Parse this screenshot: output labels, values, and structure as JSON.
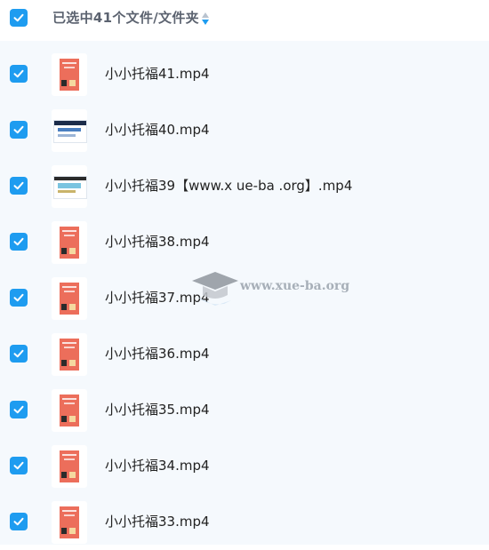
{
  "header": {
    "selection_label": "已选中41个文件/文件夹",
    "checked": true
  },
  "colors": {
    "accent": "#1e9cf0",
    "list_bg": "#f5f9fd",
    "poster": "#ec6e5b"
  },
  "files": [
    {
      "name": "小小托福41.mp4",
      "thumb": "poster"
    },
    {
      "name": "小小托福40.mp4",
      "thumb": "slide"
    },
    {
      "name": "小小托福39【www.x ue-ba .org】.mp4",
      "thumb": "slide-alt"
    },
    {
      "name": "小小托福38.mp4",
      "thumb": "poster"
    },
    {
      "name": "小小托福37.mp4",
      "thumb": "poster"
    },
    {
      "name": "小小托福36.mp4",
      "thumb": "poster"
    },
    {
      "name": "小小托福35.mp4",
      "thumb": "poster"
    },
    {
      "name": "小小托福34.mp4",
      "thumb": "poster"
    },
    {
      "name": "小小托福33.mp4",
      "thumb": "poster"
    }
  ],
  "watermark": {
    "text": "www.xue-ba.org",
    "icon": "graduation-cap-icon"
  }
}
